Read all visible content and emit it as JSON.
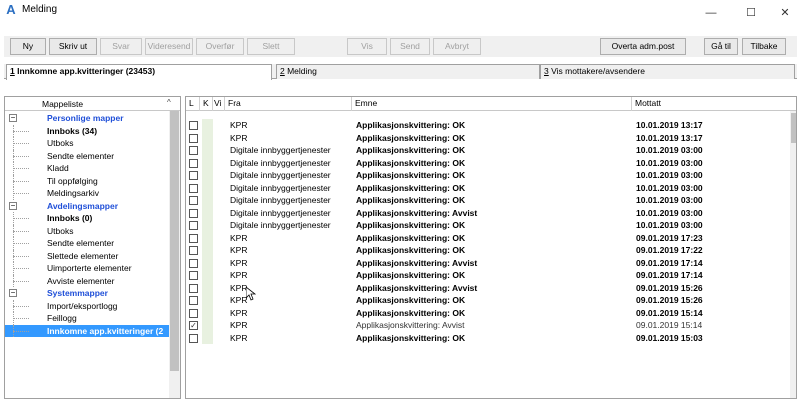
{
  "window": {
    "title": "Melding",
    "icon_glyph": "A",
    "minimize_glyph": "—",
    "maximize_glyph": "☐",
    "close_glyph": "✕"
  },
  "toolbar": {
    "buttons": [
      {
        "label": "Ny",
        "enabled": true
      },
      {
        "label": "Skriv ut",
        "enabled": true
      },
      {
        "label": "Svar",
        "enabled": false
      },
      {
        "label": "Videresend",
        "enabled": false
      },
      {
        "label": "Overfør",
        "enabled": false
      },
      {
        "label": "Slett",
        "enabled": false
      },
      {
        "label": "Vis",
        "enabled": false
      },
      {
        "label": "Send",
        "enabled": false
      },
      {
        "label": "Avbryt",
        "enabled": false
      },
      {
        "label": "Overta adm.post",
        "enabled": true
      },
      {
        "label": "Gå til",
        "enabled": true
      },
      {
        "label": "Tilbake",
        "enabled": true
      }
    ]
  },
  "tabs": [
    {
      "key": "1",
      "label": " Innkomne app.kvitteringer (23453)",
      "active": true
    },
    {
      "key": "2",
      "label": " Melding",
      "active": false
    },
    {
      "key": "3",
      "label": " Vis mottakere/avsendere",
      "active": false
    }
  ],
  "tree": {
    "header": "Mappeliste",
    "sort_glyph": "^",
    "items": [
      {
        "label": "Personlige mapper",
        "type": "group"
      },
      {
        "label": "Innboks (34)",
        "type": "bold"
      },
      {
        "label": "Utboks",
        "type": "item"
      },
      {
        "label": "Sendte elementer",
        "type": "item"
      },
      {
        "label": "Kladd",
        "type": "item"
      },
      {
        "label": "Til oppfølging",
        "type": "item"
      },
      {
        "label": "Meldingsarkiv",
        "type": "item"
      },
      {
        "label": "Avdelingsmapper",
        "type": "group"
      },
      {
        "label": "Innboks (0)",
        "type": "bold"
      },
      {
        "label": "Utboks",
        "type": "item"
      },
      {
        "label": "Sendte elementer",
        "type": "item"
      },
      {
        "label": "Slettede elementer",
        "type": "item"
      },
      {
        "label": "Uimporterte elementer",
        "type": "item"
      },
      {
        "label": "Avviste elementer",
        "type": "item"
      },
      {
        "label": "Systemmapper",
        "type": "group"
      },
      {
        "label": "Import/eksportlogg",
        "type": "item"
      },
      {
        "label": "Feillogg",
        "type": "item"
      },
      {
        "label": "Innkomne app.kvitteringer (2",
        "type": "selected"
      }
    ]
  },
  "grid": {
    "columns": {
      "l": "L",
      "k": "K",
      "v": "Vi",
      "fra": "Fra",
      "emne": "Emne",
      "mottatt": "Mottatt"
    },
    "rows": [
      {
        "fra": "KPR",
        "emne": "Applikasjonskvittering: OK",
        "mottatt": "10.01.2019 13:17",
        "checked": false,
        "bold": true
      },
      {
        "fra": "KPR",
        "emne": "Applikasjonskvittering: OK",
        "mottatt": "10.01.2019 13:17",
        "checked": false,
        "bold": true
      },
      {
        "fra": "Digitale innbyggertjenester",
        "emne": "Applikasjonskvittering: OK",
        "mottatt": "10.01.2019 03:00",
        "checked": false,
        "bold": true
      },
      {
        "fra": "Digitale innbyggertjenester",
        "emne": "Applikasjonskvittering: OK",
        "mottatt": "10.01.2019 03:00",
        "checked": false,
        "bold": true
      },
      {
        "fra": "Digitale innbyggertjenester",
        "emne": "Applikasjonskvittering: OK",
        "mottatt": "10.01.2019 03:00",
        "checked": false,
        "bold": true
      },
      {
        "fra": "Digitale innbyggertjenester",
        "emne": "Applikasjonskvittering: OK",
        "mottatt": "10.01.2019 03:00",
        "checked": false,
        "bold": true
      },
      {
        "fra": "Digitale innbyggertjenester",
        "emne": "Applikasjonskvittering: OK",
        "mottatt": "10.01.2019 03:00",
        "checked": false,
        "bold": true
      },
      {
        "fra": "Digitale innbyggertjenester",
        "emne": "Applikasjonskvittering: Avvist",
        "mottatt": "10.01.2019 03:00",
        "checked": false,
        "bold": true
      },
      {
        "fra": "Digitale innbyggertjenester",
        "emne": "Applikasjonskvittering: OK",
        "mottatt": "10.01.2019 03:00",
        "checked": false,
        "bold": true
      },
      {
        "fra": "KPR",
        "emne": "Applikasjonskvittering: OK",
        "mottatt": "09.01.2019 17:23",
        "checked": false,
        "bold": true
      },
      {
        "fra": "KPR",
        "emne": "Applikasjonskvittering: OK",
        "mottatt": "09.01.2019 17:22",
        "checked": false,
        "bold": true
      },
      {
        "fra": "KPR",
        "emne": "Applikasjonskvittering: Avvist",
        "mottatt": "09.01.2019 17:14",
        "checked": false,
        "bold": true
      },
      {
        "fra": "KPR",
        "emne": "Applikasjonskvittering: OK",
        "mottatt": "09.01.2019 17:14",
        "checked": false,
        "bold": true
      },
      {
        "fra": "KPR",
        "emne": "Applikasjonskvittering: Avvist",
        "mottatt": "09.01.2019 15:26",
        "checked": false,
        "bold": true
      },
      {
        "fra": "KPR",
        "emne": "Applikasjonskvittering: OK",
        "mottatt": "09.01.2019 15:26",
        "checked": false,
        "bold": true
      },
      {
        "fra": "KPR",
        "emne": "Applikasjonskvittering: OK",
        "mottatt": "09.01.2019 15:14",
        "checked": false,
        "bold": true
      },
      {
        "fra": "KPR",
        "emne": "Applikasjonskvittering: Avvist",
        "mottatt": "09.01.2019 15:14",
        "checked": true,
        "bold": false
      },
      {
        "fra": "KPR",
        "emne": "Applikasjonskvittering: OK",
        "mottatt": "09.01.2019 15:03",
        "checked": false,
        "bold": true
      }
    ]
  }
}
